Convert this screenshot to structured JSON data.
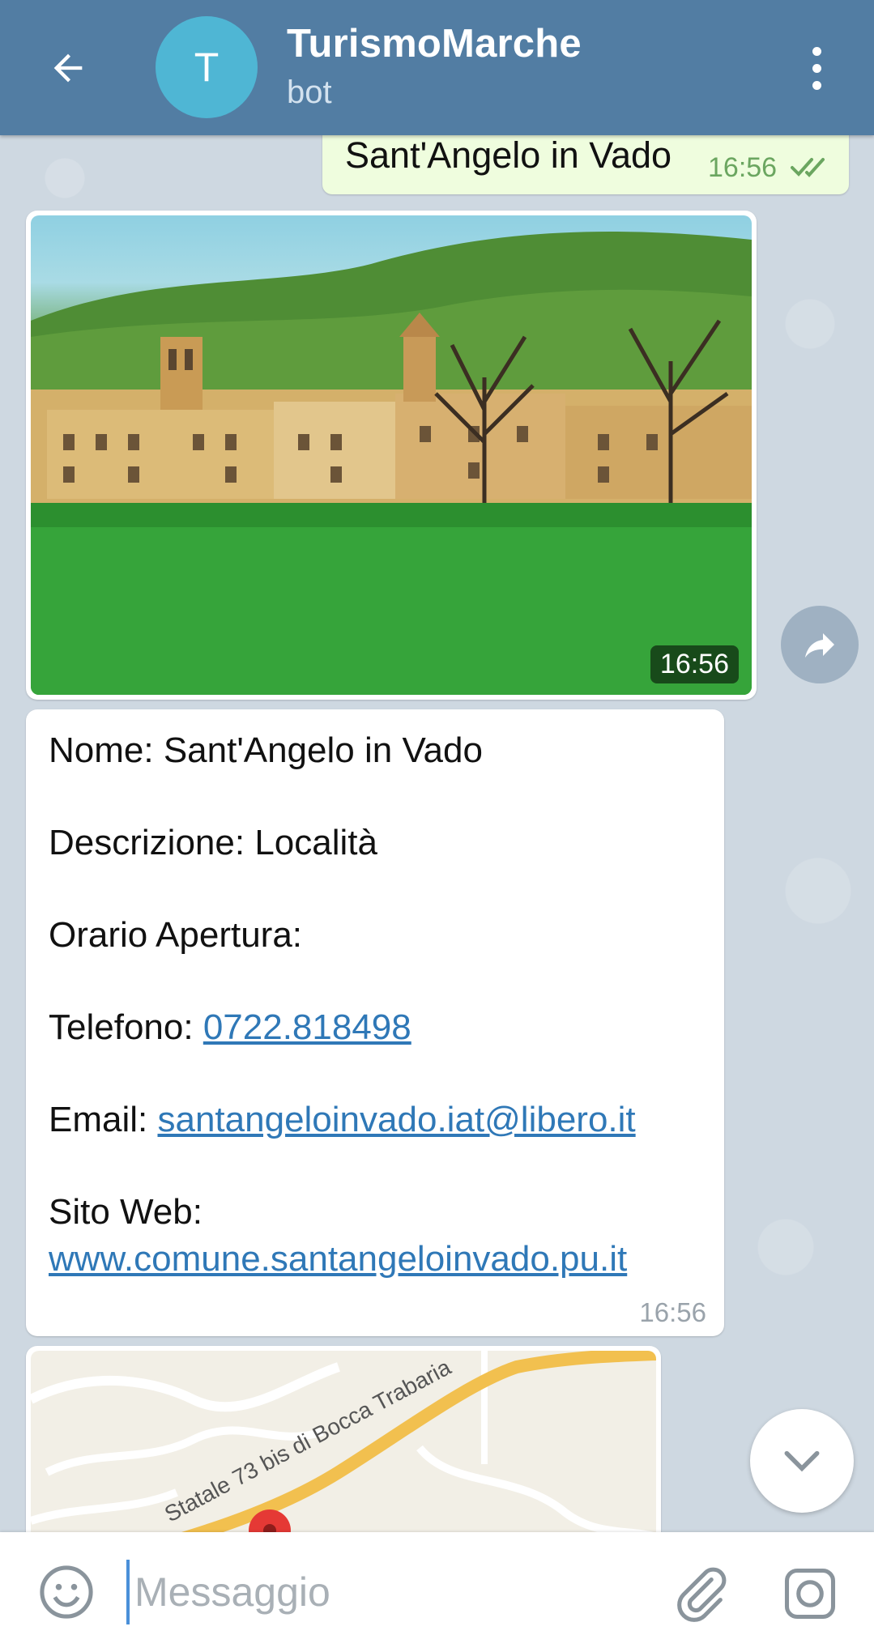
{
  "header": {
    "avatar_letter": "T",
    "title": "TurismoMarche",
    "subtitle": "bot",
    "colors": {
      "bar": "#527da3",
      "avatar": "#4fb6d4"
    }
  },
  "messages": {
    "outgoing": {
      "text": "Sant'Angelo in Vado",
      "time": "16:56",
      "status": "read"
    },
    "photo": {
      "time": "16:56"
    },
    "info": {
      "nome_label": "Nome:",
      "nome_value": "Sant'Angelo in Vado",
      "descrizione_label": "Descrizione:",
      "descrizione_value": "Località",
      "orario_label": "Orario Apertura:",
      "telefono_label": "Telefono:",
      "telefono_value": "0722.818498",
      "email_label": "Email:",
      "email_value": "santangeloinvado.iat@libero.it",
      "sito_label": "Sito Web:",
      "sito_value": "www.comune.santangeloinvado.pu.it",
      "time": "16:56"
    },
    "map": {
      "road_label": "Statale 73 bis di Bocca Trabaria"
    }
  },
  "input": {
    "placeholder": "Messaggio"
  },
  "icons": [
    "back-arrow-icon",
    "more-vertical-icon",
    "double-check-icon",
    "share-icon",
    "chevron-down-icon",
    "emoji-icon",
    "attach-icon",
    "camera-icon",
    "map-pin-icon"
  ]
}
